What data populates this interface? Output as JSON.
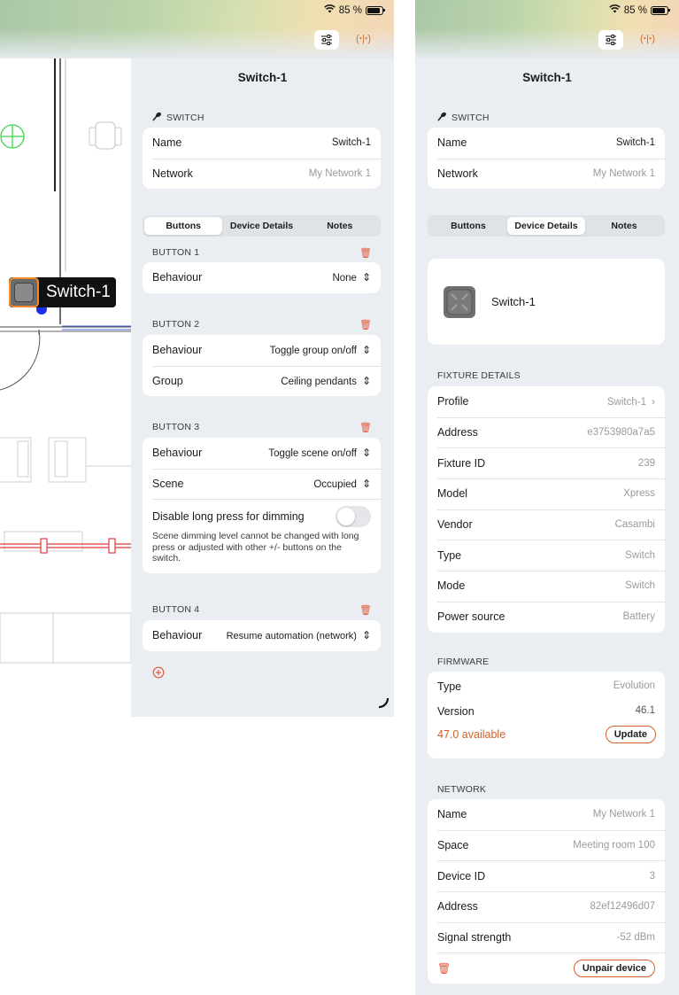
{
  "status": {
    "battery_pct": "85 %"
  },
  "plan": {
    "device_label": "Switch-1"
  },
  "left_panel": {
    "title": "Switch-1",
    "section": "SWITCH",
    "info_rows": [
      {
        "label": "Name",
        "value": "Switch-1"
      },
      {
        "label": "Network",
        "value": "My Network 1"
      }
    ],
    "tabs": [
      {
        "label": "Buttons",
        "active": true
      },
      {
        "label": "Device Details",
        "active": false
      },
      {
        "label": "Notes",
        "active": false
      }
    ],
    "buttons": [
      {
        "header": "BUTTON 1",
        "rows": [
          {
            "label": "Behaviour",
            "value": "None"
          }
        ]
      },
      {
        "header": "BUTTON 2",
        "rows": [
          {
            "label": "Behaviour",
            "value": "Toggle group on/off"
          },
          {
            "label": "Group",
            "value": "Ceiling pendants"
          }
        ]
      },
      {
        "header": "BUTTON 3",
        "rows": [
          {
            "label": "Behaviour",
            "value": "Toggle scene on/off"
          },
          {
            "label": "Scene",
            "value": "Occupied"
          }
        ],
        "toggle_label": "Disable long press for dimming",
        "toggle_on": false,
        "footnote": "Scene dimming level cannot be changed with long press or adjusted with other +/- buttons on the switch."
      },
      {
        "header": "BUTTON 4",
        "rows": [
          {
            "label": "Behaviour",
            "value": "Resume automation (network)"
          }
        ]
      }
    ]
  },
  "right_panel": {
    "title": "Switch-1",
    "section": "SWITCH",
    "info_rows": [
      {
        "label": "Name",
        "value": "Switch-1"
      },
      {
        "label": "Network",
        "value": "My Network 1"
      }
    ],
    "tabs": [
      {
        "label": "Buttons",
        "active": false
      },
      {
        "label": "Device Details",
        "active": true
      },
      {
        "label": "Notes",
        "active": false
      }
    ],
    "device_name": "Switch-1",
    "fixture_header": "FIXTURE DETAILS",
    "fixture_rows": [
      {
        "label": "Profile",
        "value": "Switch-1"
      },
      {
        "label": "Address",
        "value": "e3753980a7a5"
      },
      {
        "label": "Fixture ID",
        "value": "239"
      },
      {
        "label": "Model",
        "value": "Xpress"
      },
      {
        "label": "Vendor",
        "value": "Casambi"
      },
      {
        "label": "Type",
        "value": "Switch"
      },
      {
        "label": "Mode",
        "value": "Switch"
      },
      {
        "label": "Power source",
        "value": "Battery"
      }
    ],
    "firmware_header": "FIRMWARE",
    "firmware_type_label": "Type",
    "firmware_type_value": "Evolution",
    "firmware_version_label": "Version",
    "firmware_version_value": "46.1",
    "firmware_available": "47.0 available",
    "update_label": "Update",
    "network_header": "NETWORK",
    "network_rows": [
      {
        "label": "Name",
        "value": "My Network 1"
      },
      {
        "label": "Space",
        "value": "Meeting room 100"
      },
      {
        "label": "Device ID",
        "value": "3"
      },
      {
        "label": "Address",
        "value": "82ef12496d07"
      },
      {
        "label": "Signal strength",
        "value": "-52 dBm"
      }
    ],
    "unpair_label": "Unpair device"
  },
  "colors": {
    "accent": "#d0602a",
    "panel_bg": "#eaedf1",
    "trash": "#e0593d"
  }
}
